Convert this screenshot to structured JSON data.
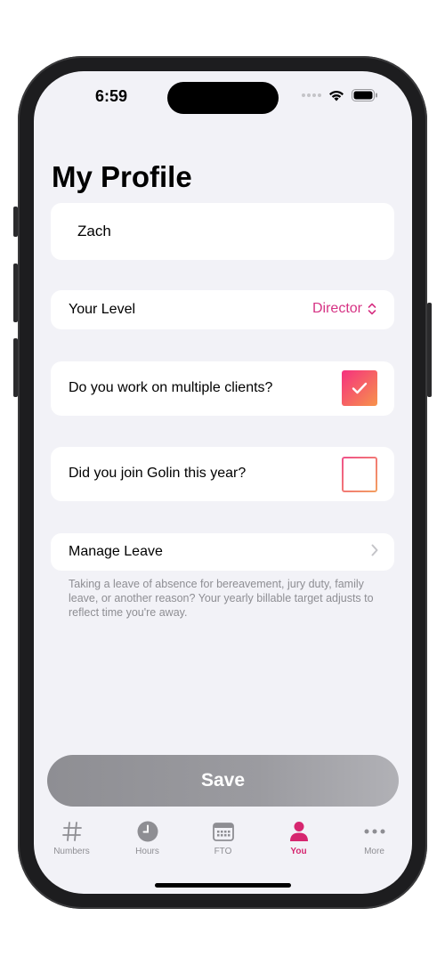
{
  "status_bar": {
    "time": "6:59"
  },
  "page": {
    "title": "My Profile"
  },
  "profile": {
    "name": "Zach",
    "level_label": "Your Level",
    "level_value": "Director",
    "multiple_clients_label": "Do you work on multiple clients?",
    "multiple_clients_checked": true,
    "joined_this_year_label": "Did you join Golin this year?",
    "joined_this_year_checked": false,
    "manage_leave_label": "Manage Leave",
    "manage_leave_note": "Taking a leave of absence for bereavement, jury duty, family leave, or another reason? Your yearly billable target adjusts to reflect time you're away."
  },
  "actions": {
    "save_label": "Save"
  },
  "tabs": [
    {
      "label": "Numbers",
      "icon": "hash-icon",
      "active": false
    },
    {
      "label": "Hours",
      "icon": "clock-icon",
      "active": false
    },
    {
      "label": "FTO",
      "icon": "calendar-icon",
      "active": false
    },
    {
      "label": "You",
      "icon": "person-icon",
      "active": true
    },
    {
      "label": "More",
      "icon": "ellipsis-icon",
      "active": false
    }
  ],
  "colors": {
    "accent": "#d63384",
    "checkbox_gradient_start": "#f5317f",
    "checkbox_gradient_end": "#f7934b",
    "save_button": "#8e8e93",
    "background": "#f2f2f7"
  }
}
